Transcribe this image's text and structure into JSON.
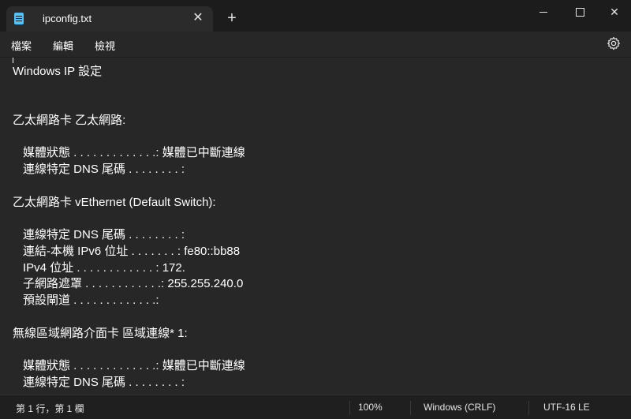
{
  "tab": {
    "title": "ipconfig.txt",
    "close_glyph": "✕",
    "new_tab_glyph": "+"
  },
  "window_controls": {
    "close_glyph": "✕"
  },
  "menu": {
    "file": "檔案",
    "edit": "編輯",
    "view": "檢視"
  },
  "editor": {
    "lines": [
      "Windows IP 設定",
      "乙太網路卡 乙太網路:",
      "媒體狀態 . . . . . . . . . . . . .: 媒體已中斷連線",
      "連線特定 DNS 尾碼 . . . . . . . . :",
      "乙太網路卡 vEthernet (Default Switch):",
      "連線特定 DNS 尾碼 . . . . . . . . :",
      "連結-本機 IPv6 位址 . . . . . . . : fe80::bb88",
      "IPv4 位址 . . . . . . . . . . . . : 172.",
      "子網路遮罩 . . . . . . . . . . . .: 255.255.240.0",
      "預設閘道 . . . . . . . . . . . . .:",
      "無線區域網路介面卡 區域連線* 1:",
      "媒體狀態 . . . . . . . . . . . . .: 媒體已中斷連線",
      "連線特定 DNS 尾碼 . . . . . . . . :"
    ]
  },
  "status": {
    "position": "第 1 行，第 1 欄",
    "zoom": "100%",
    "line_ending": "Windows (CRLF)",
    "encoding": "UTF-16 LE"
  },
  "colors": {
    "background": "#272727",
    "titlebar": "#1c1c1c",
    "text": "#ffffff"
  },
  "icons": {
    "tab": "notepad-icon",
    "settings": "gear-icon"
  }
}
